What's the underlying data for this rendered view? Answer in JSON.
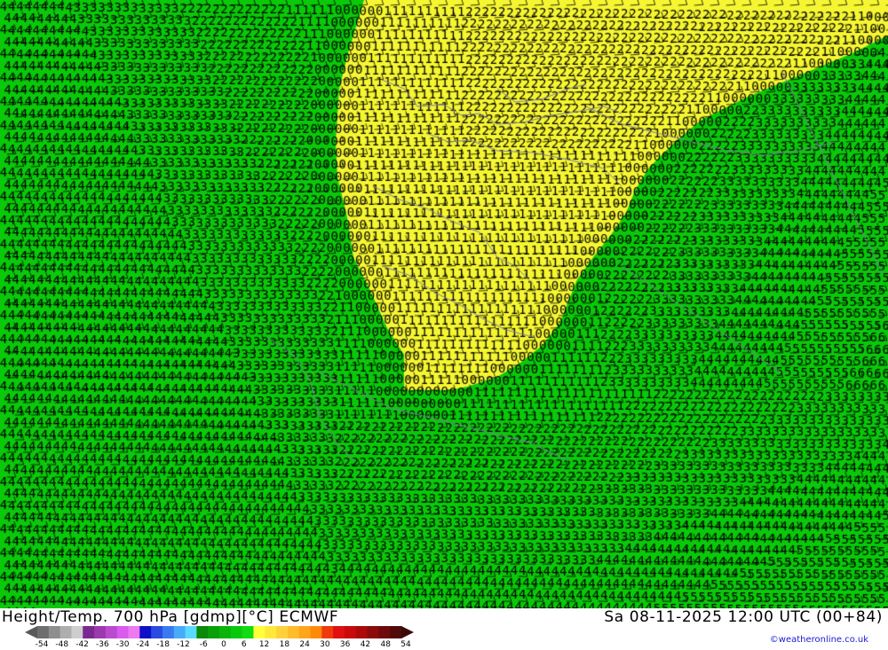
{
  "map": {
    "colors": {
      "green_field": "#0ac80a",
      "yellow_field": "#f5f532",
      "border_line": "#7c7c9c",
      "barb": "#000000",
      "digit": "#000000"
    }
  },
  "footer": {
    "title": "Height/Temp. 700 hPa [gdmp][°C] ECMWF",
    "datetime": "Sa 08-11-2025 12:00 UTC (00+84)",
    "credit": "©weatheronline.co.uk"
  },
  "colorbar": {
    "colors": [
      "#6e6e6e",
      "#8e8e8e",
      "#aeaeae",
      "#cecece",
      "#7a2a8e",
      "#9a3aae",
      "#ba4ace",
      "#da5aee",
      "#ee7af2",
      "#1010c8",
      "#2a4ae0",
      "#3a7af0",
      "#4aaafa",
      "#5adaff",
      "#0a8a0a",
      "#0aa00a",
      "#0ab40a",
      "#0ac80a",
      "#10dc10",
      "#ffff3a",
      "#ffe83a",
      "#ffd23a",
      "#ffbc2a",
      "#ffa61a",
      "#ff8a0a",
      "#f03a0a",
      "#e01010",
      "#c80a0a",
      "#aa0a0a",
      "#8c0a0a",
      "#6e0a0a",
      "#500a0a"
    ],
    "tick_labels": [
      "-54",
      "-48",
      "-42",
      "-36",
      "-30",
      "-24",
      "-18",
      "-12",
      "-6",
      "0",
      "6",
      "12",
      "18",
      "24",
      "30",
      "36",
      "42",
      "48",
      "54"
    ]
  }
}
